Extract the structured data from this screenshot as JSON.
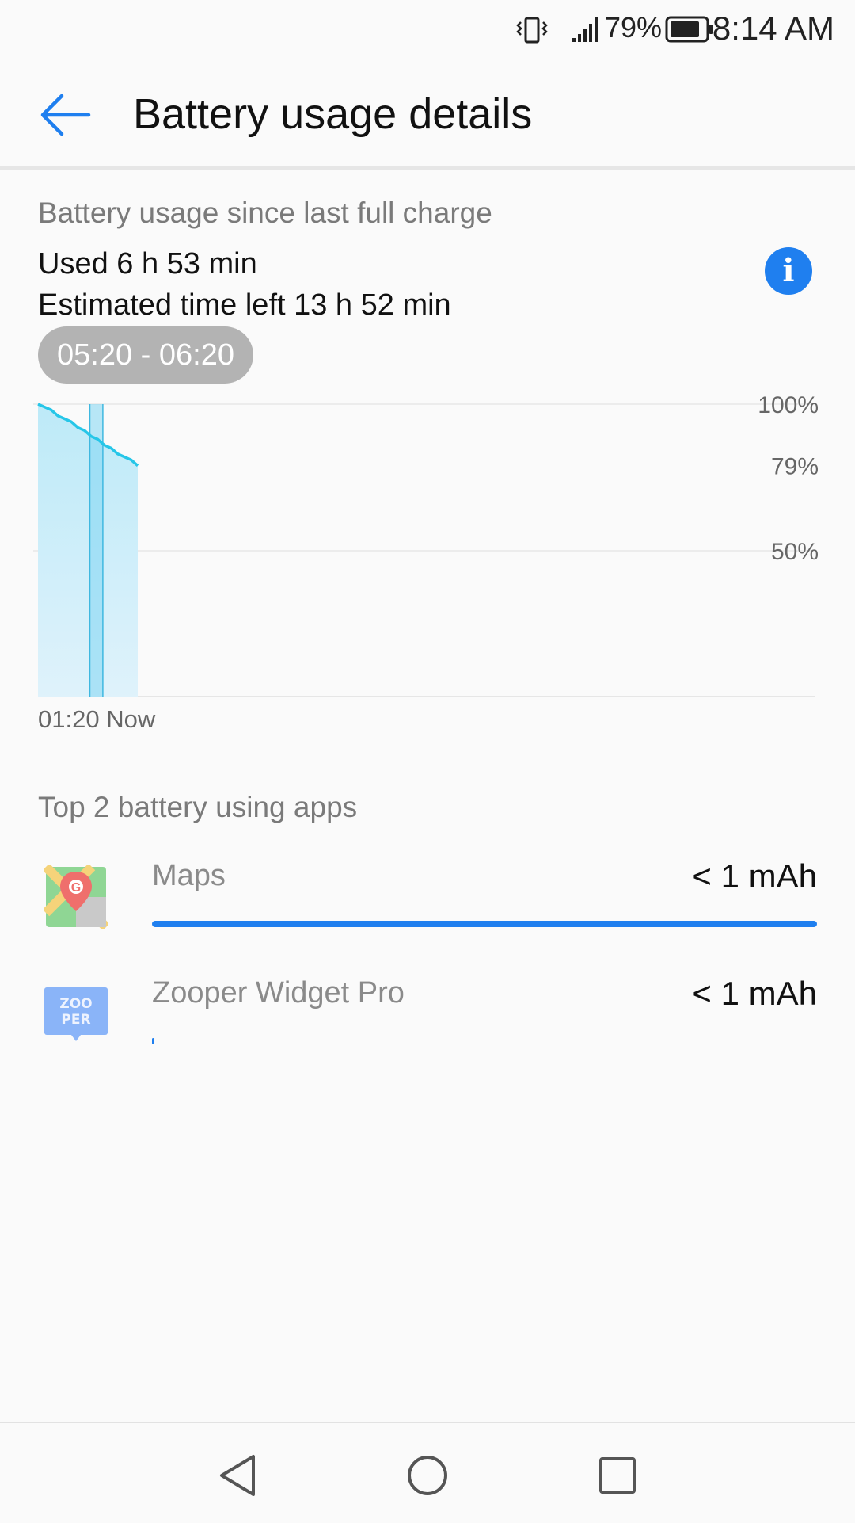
{
  "status_bar": {
    "battery_percent": "79%",
    "time": "8:14 AM",
    "icons": [
      "vibrate-icon",
      "signal-icon",
      "battery-icon"
    ]
  },
  "app_bar": {
    "title": "Battery usage details",
    "back_icon": "arrow-back-icon"
  },
  "summary": {
    "caption": "Battery usage since last full charge",
    "used": "Used 6 h 53 min",
    "estimated": "Estimated time left 13 h 52 min",
    "info_icon_glyph": "i",
    "selected_range": "05:20 - 06:20"
  },
  "chart_data": {
    "type": "area",
    "ylabels": [
      "100%",
      "79%",
      "50%"
    ],
    "xlabels": [
      "01:20",
      "Now"
    ],
    "ylim": [
      0,
      100
    ],
    "grid": true,
    "series": [
      {
        "values": [
          100,
          99,
          98,
          96,
          95,
          94,
          92,
          91,
          89,
          88,
          86,
          85,
          83,
          82,
          81,
          79
        ]
      }
    ],
    "highlight_range": [
      0.52,
      0.65
    ],
    "color": "#26c6e8"
  },
  "top_apps": {
    "caption": "Top 2 battery using apps",
    "items": [
      {
        "name": "Maps",
        "amount": "< 1 mAh",
        "share": 1.0,
        "icon": "maps-icon"
      },
      {
        "name": "Zooper Widget Pro",
        "amount": "< 1 mAh",
        "share": 0.003,
        "icon": "zooper-icon",
        "icon_text": [
          "ZOO",
          "PER"
        ]
      }
    ]
  },
  "nav_bar": {
    "icons": [
      "back-triangle-icon",
      "home-circle-icon",
      "recents-square-icon"
    ]
  },
  "colors": {
    "accent": "#1f7fef",
    "chart_fill": "#c3ecf8",
    "chart_line": "#26c6e8",
    "pill": "#b3b3b3"
  }
}
